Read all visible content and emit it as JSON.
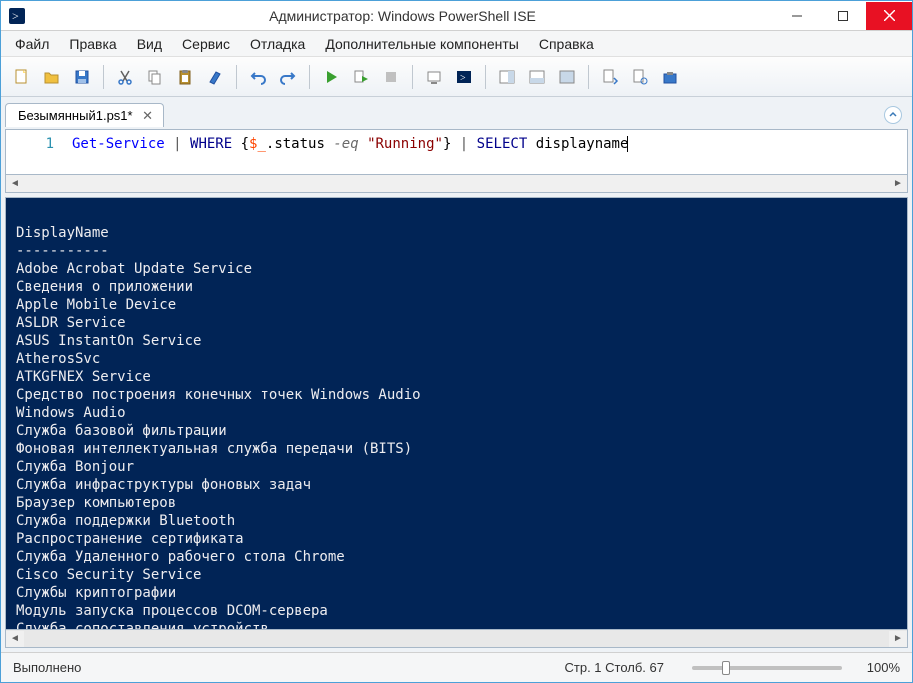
{
  "window": {
    "title": "Администратор: Windows PowerShell ISE"
  },
  "menu": {
    "file": "Файл",
    "edit": "Правка",
    "view": "Вид",
    "tools": "Сервис",
    "debug": "Отладка",
    "addons": "Дополнительные компоненты",
    "help": "Справка"
  },
  "toolbar_icons": {
    "new": "new-file-icon",
    "open": "open-folder-icon",
    "save": "save-icon",
    "cut": "cut-icon",
    "copy": "copy-icon",
    "paste": "paste-icon",
    "clear": "clear-icon",
    "undo": "undo-icon",
    "redo": "redo-icon",
    "run": "run-icon",
    "run_selection": "run-selection-icon",
    "stop": "stop-icon",
    "new_remote": "new-remote-icon",
    "powershell": "powershell-icon",
    "layout1": "layout-right-icon",
    "layout2": "layout-bottom-icon",
    "layout3": "layout-full-icon",
    "show_script": "show-script-icon",
    "show_command": "show-command-icon",
    "tools2": "tool-icon"
  },
  "tabs": [
    {
      "label": "Безымянный1.ps1*"
    }
  ],
  "editor": {
    "line_number": "1",
    "tokens": {
      "get_service": "Get-Service",
      "pipe1": " | ",
      "where": "WHERE",
      "lbrace": " {",
      "var": "$_",
      "dot": ".",
      "member": "status",
      "sp1": " ",
      "eq": "-eq",
      "sp2": " ",
      "string": "\"Running\"",
      "rbrace": "}",
      "pipe2": " | ",
      "select": "SELECT",
      "sp3": " ",
      "displayname": "displayname"
    }
  },
  "console": {
    "header": "DisplayName",
    "divider": "-----------",
    "lines": [
      "Adobe Acrobat Update Service",
      "Сведения о приложении",
      "Apple Mobile Device",
      "ASLDR Service",
      "ASUS InstantOn Service",
      "AtherosSvc",
      "ATKGFNEX Service",
      "Средство построения конечных точек Windows Audio",
      "Windows Audio",
      "Служба базовой фильтрации",
      "Фоновая интеллектуальная служба передачи (BITS)",
      "Служба Bonjour",
      "Служба инфраструктуры фоновых задач",
      "Браузер компьютеров",
      "Служба поддержки Bluetooth",
      "Распространение сертификата",
      "Служба Удаленного рабочего стола Chrome",
      "Cisco Security Service",
      "Службы криптографии",
      "Модуль запуска процессов DCOM-сервера",
      "Служба сопоставления устройств"
    ]
  },
  "status": {
    "state": "Выполнено",
    "cursor": "Стр. 1 Столб. 67",
    "zoom": "100%"
  }
}
